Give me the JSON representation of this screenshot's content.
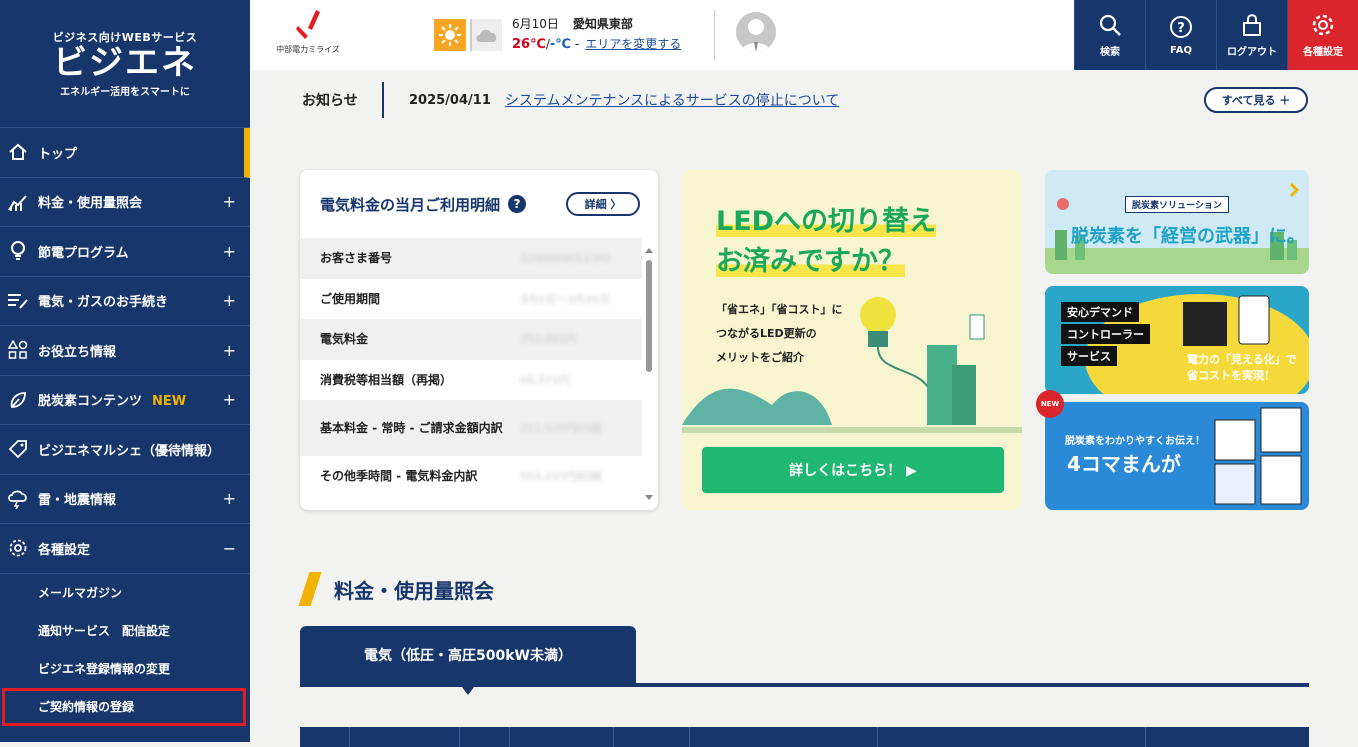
{
  "brand": {
    "tagline": "ビジネス向けWEBサービス",
    "logo": "ビジエネ",
    "subtitle": "エネルギー活用をスマートに"
  },
  "sidebar": {
    "items": [
      {
        "label": "トップ",
        "icon": "home-icon",
        "active": true
      },
      {
        "label": "料金・使用量照会",
        "icon": "chart-icon",
        "toggle": "+"
      },
      {
        "label": "節電プログラム",
        "icon": "bulb-icon",
        "toggle": "+"
      },
      {
        "label": "電気・ガスのお手続き",
        "icon": "list-edit-icon",
        "toggle": "+"
      },
      {
        "label": "お役立ち情報",
        "icon": "shapes-icon",
        "toggle": "+"
      },
      {
        "label": "脱炭素コンテンツ",
        "badge": "NEW",
        "icon": "leaf-icon",
        "toggle": "+"
      },
      {
        "label": "ビジエネマルシェ（優待情報）",
        "icon": "tag-icon",
        "toggle": ""
      },
      {
        "label": "雷・地震情報",
        "icon": "thunder-cloud-icon",
        "toggle": "+"
      },
      {
        "label": "各種設定",
        "icon": "gear-icon",
        "toggle": "−"
      }
    ],
    "subitems": [
      {
        "label": "メールマガジン"
      },
      {
        "label": "通知サービス　配信設定"
      },
      {
        "label": "ビジエネ登録情報の変更"
      },
      {
        "label": "ご契約情報の登録",
        "highlighted": true
      }
    ]
  },
  "header": {
    "company_text": "中部電力ミライズ",
    "weather": {
      "date": "6月10日",
      "area": "愛知県東部",
      "high": "26℃",
      "slash": "/",
      "low": "-℃",
      "dash": "-",
      "change_area": "エリアを変更する"
    },
    "tools": [
      {
        "label": "検索",
        "icon": "search-icon"
      },
      {
        "label": "FAQ",
        "icon": "question-icon"
      },
      {
        "label": "ログアウト",
        "icon": "lock-icon"
      },
      {
        "label": "各種設定",
        "icon": "gear-icon"
      }
    ]
  },
  "notice": {
    "title": "お知らせ",
    "date": "2025/04/11",
    "text": "システムメンテナンスによるサービスの停止について",
    "see_all": "すべて見る ＋"
  },
  "bill_card": {
    "title": "電気料金の当月ご利用明細",
    "help": "?",
    "detail_button": "詳細 〉",
    "rows": [
      {
        "label": "お客さま番号",
        "value": "1290004011302"
      },
      {
        "label": "ご使用期間",
        "value": "3月1日～3月31日"
      },
      {
        "label": "電気料金",
        "value": "752,881円"
      },
      {
        "label": "消費税等相当額（再掲）",
        "value": "68,371円"
      },
      {
        "label": "基本料金 - 常時 - ご請求金額内訳",
        "value": "211,520円05銭"
      },
      {
        "label": "その他季時間 - 電気料金内訳",
        "value": "553,215円80銭"
      }
    ]
  },
  "led_card": {
    "headline_1": "LEDへの切り替え",
    "headline_2": "お済みですか？",
    "desc_1": "「省エネ」「省コスト」に",
    "desc_2": "つながるLED更新の",
    "desc_3": "メリットをご紹介",
    "button": "詳しくはこちら！ ▶"
  },
  "banners": {
    "b1_tag": "脱炭素ソリューション",
    "b1_title": "脱炭素を「経営の武器」に。",
    "b2_lines": [
      "安心デマンド",
      "コントローラー",
      "サービス"
    ],
    "b2_caption_1": "電力の「見える化」で",
    "b2_caption_2": "省コストを実現！",
    "b3_badge": "NEW",
    "b3_small": "脱炭素をわかりやすくお伝え！",
    "b3_big": "4コマまんが"
  },
  "section": {
    "title": "料金・使用量照会",
    "tab": "電気（低圧・高圧500kW未満）"
  },
  "colors": {
    "navy": "#17366b",
    "accent": "#f0b400",
    "red": "#d9252b",
    "green": "#1fb771"
  }
}
